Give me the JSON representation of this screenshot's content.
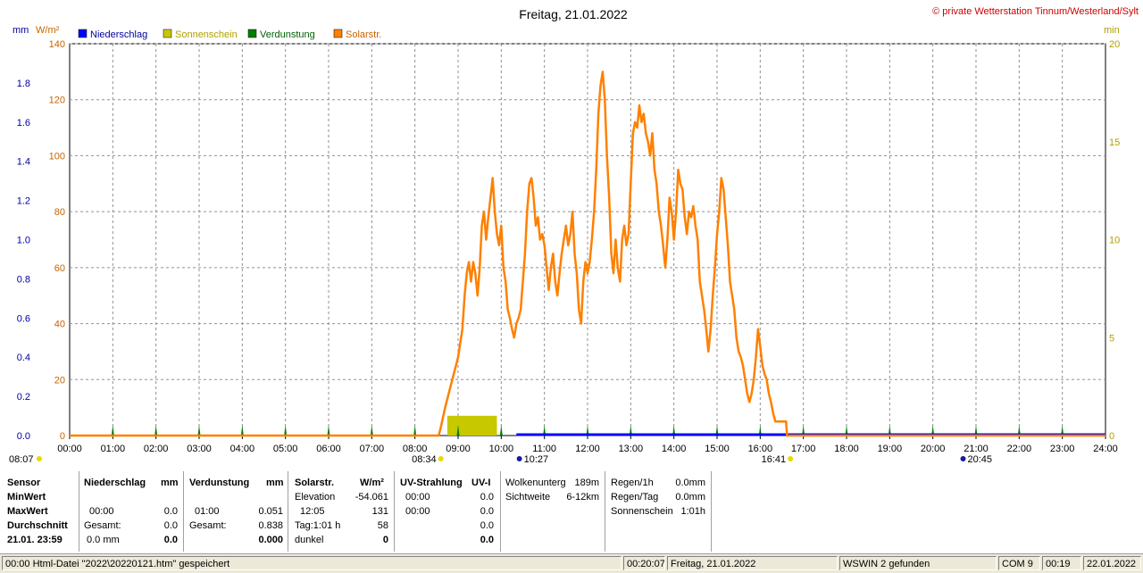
{
  "chart_data": {
    "type": "line",
    "title": "Freitag, 21.01.2022",
    "copyright": "© private Wetterstation Tinnum/Westerland/Sylt",
    "left_unit_mm": "mm",
    "left_unit_wm2": "W/m²",
    "right_unit": "min",
    "legend": [
      {
        "name": "Niederschlag",
        "color": "#0000ff"
      },
      {
        "name": "Sonnenschein",
        "color": "#c8c800"
      },
      {
        "name": "Verdunstung",
        "color": "#008000"
      },
      {
        "name": "Solarstr.",
        "color": "#ff8000"
      }
    ],
    "legend_text_colors": [
      "#0000a0",
      "#b0a000",
      "#006000",
      "#c86400"
    ],
    "x_ticks": [
      "00:00",
      "01:00",
      "02:00",
      "03:00",
      "04:00",
      "05:00",
      "06:00",
      "07:00",
      "08:00",
      "09:00",
      "10:00",
      "11:00",
      "12:00",
      "13:00",
      "14:00",
      "15:00",
      "16:00",
      "17:00",
      "18:00",
      "19:00",
      "20:00",
      "21:00",
      "22:00",
      "23:00",
      "24:00"
    ],
    "xlim": [
      0,
      24
    ],
    "y_mm_ticks": [
      "0.0",
      "0.2",
      "0.4",
      "0.6",
      "0.8",
      "1.0",
      "1.2",
      "1.4",
      "1.6",
      "1.8"
    ],
    "ylim_mm": [
      0,
      2.0
    ],
    "y_wm2_ticks": [
      "0",
      "20",
      "40",
      "60",
      "80",
      "100",
      "120",
      "140"
    ],
    "ylim_wm2": [
      0,
      140
    ],
    "y_min_ticks": [
      "0",
      "5",
      "10",
      "15",
      "20"
    ],
    "ylim_min": [
      0,
      20
    ],
    "grid": true,
    "series": [
      {
        "name": "Solarstr.",
        "color": "#ff8000",
        "points": [
          [
            0,
            0
          ],
          [
            8.55,
            0
          ],
          [
            8.6,
            3
          ],
          [
            8.7,
            10
          ],
          [
            8.8,
            16
          ],
          [
            8.9,
            22
          ],
          [
            9.0,
            28
          ],
          [
            9.1,
            38
          ],
          [
            9.15,
            50
          ],
          [
            9.2,
            58
          ],
          [
            9.25,
            62
          ],
          [
            9.3,
            55
          ],
          [
            9.35,
            62
          ],
          [
            9.4,
            58
          ],
          [
            9.45,
            50
          ],
          [
            9.5,
            60
          ],
          [
            9.55,
            75
          ],
          [
            9.6,
            80
          ],
          [
            9.65,
            70
          ],
          [
            9.7,
            78
          ],
          [
            9.75,
            85
          ],
          [
            9.8,
            92
          ],
          [
            9.85,
            80
          ],
          [
            9.9,
            72
          ],
          [
            9.95,
            68
          ],
          [
            10.0,
            75
          ],
          [
            10.05,
            60
          ],
          [
            10.1,
            55
          ],
          [
            10.15,
            45
          ],
          [
            10.2,
            42
          ],
          [
            10.25,
            38
          ],
          [
            10.3,
            35
          ],
          [
            10.35,
            40
          ],
          [
            10.4,
            42
          ],
          [
            10.45,
            45
          ],
          [
            10.5,
            55
          ],
          [
            10.55,
            65
          ],
          [
            10.6,
            80
          ],
          [
            10.65,
            90
          ],
          [
            10.7,
            92
          ],
          [
            10.75,
            85
          ],
          [
            10.8,
            75
          ],
          [
            10.85,
            78
          ],
          [
            10.9,
            70
          ],
          [
            10.95,
            72
          ],
          [
            11.0,
            68
          ],
          [
            11.05,
            60
          ],
          [
            11.1,
            52
          ],
          [
            11.15,
            60
          ],
          [
            11.2,
            65
          ],
          [
            11.25,
            55
          ],
          [
            11.3,
            50
          ],
          [
            11.35,
            58
          ],
          [
            11.4,
            65
          ],
          [
            11.45,
            70
          ],
          [
            11.5,
            75
          ],
          [
            11.55,
            68
          ],
          [
            11.6,
            72
          ],
          [
            11.65,
            80
          ],
          [
            11.7,
            65
          ],
          [
            11.75,
            58
          ],
          [
            11.8,
            45
          ],
          [
            11.85,
            40
          ],
          [
            11.9,
            55
          ],
          [
            11.95,
            62
          ],
          [
            12.0,
            58
          ],
          [
            12.05,
            62
          ],
          [
            12.1,
            70
          ],
          [
            12.15,
            80
          ],
          [
            12.2,
            95
          ],
          [
            12.25,
            115
          ],
          [
            12.3,
            125
          ],
          [
            12.35,
            130
          ],
          [
            12.4,
            120
          ],
          [
            12.45,
            100
          ],
          [
            12.5,
            85
          ],
          [
            12.55,
            65
          ],
          [
            12.6,
            58
          ],
          [
            12.65,
            70
          ],
          [
            12.7,
            60
          ],
          [
            12.75,
            55
          ],
          [
            12.8,
            70
          ],
          [
            12.85,
            75
          ],
          [
            12.9,
            68
          ],
          [
            12.95,
            72
          ],
          [
            13.0,
            90
          ],
          [
            13.05,
            108
          ],
          [
            13.1,
            112
          ],
          [
            13.15,
            110
          ],
          [
            13.2,
            118
          ],
          [
            13.25,
            112
          ],
          [
            13.3,
            115
          ],
          [
            13.35,
            108
          ],
          [
            13.4,
            105
          ],
          [
            13.45,
            100
          ],
          [
            13.5,
            108
          ],
          [
            13.55,
            95
          ],
          [
            13.6,
            90
          ],
          [
            13.65,
            80
          ],
          [
            13.7,
            75
          ],
          [
            13.75,
            68
          ],
          [
            13.8,
            60
          ],
          [
            13.85,
            70
          ],
          [
            13.9,
            85
          ],
          [
            13.95,
            80
          ],
          [
            14.0,
            70
          ],
          [
            14.05,
            80
          ],
          [
            14.1,
            95
          ],
          [
            14.15,
            90
          ],
          [
            14.2,
            88
          ],
          [
            14.25,
            78
          ],
          [
            14.3,
            72
          ],
          [
            14.35,
            80
          ],
          [
            14.4,
            78
          ],
          [
            14.45,
            82
          ],
          [
            14.5,
            75
          ],
          [
            14.55,
            70
          ],
          [
            14.6,
            55
          ],
          [
            14.65,
            50
          ],
          [
            14.7,
            45
          ],
          [
            14.75,
            38
          ],
          [
            14.8,
            30
          ],
          [
            14.85,
            38
          ],
          [
            14.9,
            50
          ],
          [
            14.95,
            60
          ],
          [
            15.0,
            72
          ],
          [
            15.05,
            80
          ],
          [
            15.1,
            92
          ],
          [
            15.15,
            88
          ],
          [
            15.2,
            78
          ],
          [
            15.25,
            68
          ],
          [
            15.3,
            55
          ],
          [
            15.35,
            50
          ],
          [
            15.4,
            45
          ],
          [
            15.45,
            35
          ],
          [
            15.5,
            30
          ],
          [
            15.55,
            28
          ],
          [
            15.6,
            25
          ],
          [
            15.65,
            20
          ],
          [
            15.7,
            15
          ],
          [
            15.75,
            12
          ],
          [
            15.8,
            15
          ],
          [
            15.85,
            20
          ],
          [
            15.9,
            28
          ],
          [
            15.95,
            38
          ],
          [
            16.0,
            32
          ],
          [
            16.05,
            25
          ],
          [
            16.1,
            22
          ],
          [
            16.15,
            20
          ],
          [
            16.2,
            15
          ],
          [
            16.25,
            12
          ],
          [
            16.3,
            8
          ],
          [
            16.35,
            5
          ],
          [
            16.4,
            5
          ],
          [
            16.5,
            5
          ],
          [
            16.6,
            5
          ],
          [
            16.62,
            0
          ],
          [
            24,
            0
          ]
        ]
      },
      {
        "name": "Sonnenschein",
        "color": "#c8c800",
        "bars": [
          [
            8.75,
            9.9,
            1.01
          ]
        ]
      },
      {
        "name": "Niederschlag",
        "color": "#0000ff",
        "from_hour": 10.35,
        "value": 0.0
      },
      {
        "name": "Verdunstung",
        "color": "#008000",
        "value": 0.051
      }
    ],
    "markers": {
      "sunrise_left": "08:07",
      "sunset_left": "08:34",
      "moon_rise": "10:27",
      "moon_set": "20:45",
      "sun_set": "16:41"
    }
  },
  "panels": {
    "sensor": {
      "header": "Sensor",
      "min": "MinWert",
      "max": "MaxWert",
      "avg": "Durchschnitt",
      "date": "21.01. 23:59"
    },
    "niederschlag": {
      "header": "Niederschlag",
      "unit": "mm",
      "max_time": "00:00",
      "max_val": "0.0",
      "total_label": "Gesamt:",
      "total_val": "0.0",
      "avg_left": "0.0 mm",
      "avg_val": "0.0"
    },
    "verdunstung": {
      "header": "Verdunstung",
      "unit": "mm",
      "max_time": "01:00",
      "max_val": "0.051",
      "total_label": "Gesamt:",
      "total_val": "0.838",
      "avg_val": "0.000"
    },
    "solar": {
      "header": "Solarstr.",
      "unit": "W/m²",
      "elev_label": "Elevation",
      "elev_val": "-54.061",
      "max_time": "12:05",
      "max_val": "131",
      "day_label": "Tag:1:01 h",
      "day_val": "58",
      "dark_label": "dunkel",
      "dark_val": "0"
    },
    "uv": {
      "header": "UV-Strahlung",
      "unit": "UV-I",
      "min_time": "00:00",
      "min_val": "0.0",
      "max_time": "00:00",
      "max_val": "0.0",
      "r3_val": "0.0",
      "avg_val": "0.0"
    },
    "cloud": {
      "base_label": "Wolkenunterg",
      "base_val": "189m",
      "vis_label": "Sichtweite",
      "vis_val": "6-12km"
    },
    "rain": {
      "h_label": "Regen/1h",
      "h_val": "0.0mm",
      "d_label": "Regen/Tag",
      "d_val": "0.0mm",
      "sun_label": "Sonnenschein",
      "sun_val": "1:01h"
    }
  },
  "statusbar": {
    "s1": "00:00  Html-Datei  \"2022\\20220121.htm\"  gespeichert",
    "s2": "00:20:07",
    "s3": "Freitag, 21.01.2022",
    "s4": "WSWIN 2 gefunden",
    "s5": "COM 9",
    "s6": "00:19",
    "s7": "22.01.2022"
  }
}
